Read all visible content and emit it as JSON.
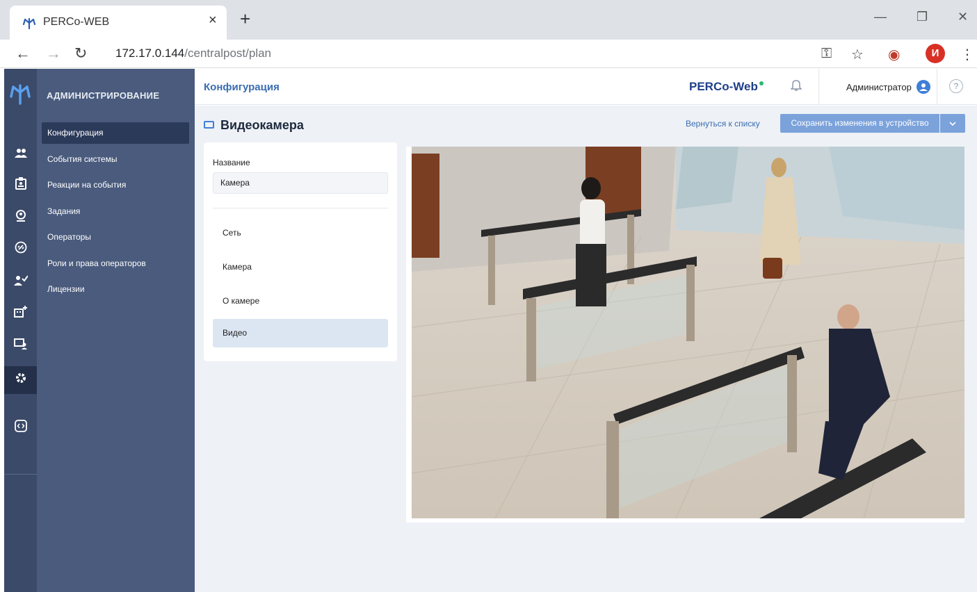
{
  "browser": {
    "tab_title": "PERCo-WEB",
    "tab_close": "×",
    "new_tab": "+",
    "url_host": "172.17.0.144",
    "url_path": "/centralpost/plan",
    "profile_initial": "И"
  },
  "header": {
    "section_title": "Конфигурация",
    "brand": "PERCo-Web",
    "user_name": "Администратор",
    "help": "?"
  },
  "sidebar": {
    "heading": "АДМИНИСТРИРОВАНИЕ",
    "items": [
      {
        "label": "Конфигурация",
        "active": true
      },
      {
        "label": "События системы"
      },
      {
        "label": "Реакции на события"
      },
      {
        "label": "Задания"
      },
      {
        "label": "Операторы"
      },
      {
        "label": "Роли и права операторов"
      },
      {
        "label": "Лицензии"
      }
    ]
  },
  "rail": {
    "icons": [
      "users-icon",
      "id-card-icon",
      "visitor-icon",
      "link-icon",
      "user-check-icon",
      "building-plus-icon",
      "monitor-user-icon",
      "gear-icon",
      "code-icon"
    ]
  },
  "page": {
    "title": "Видеокамера",
    "back_label": "Вернуться к списку",
    "save_label": "Сохранить изменения в устройство",
    "name_label": "Название",
    "name_value": "Камера",
    "menu": [
      "Сеть",
      "Камера",
      "О камере",
      "Видео"
    ]
  },
  "colors": {
    "sidebar": "#4a5b7d",
    "rail": "#3b4a68",
    "accent": "#3f7fd6",
    "save_button": "#7ba2db"
  }
}
